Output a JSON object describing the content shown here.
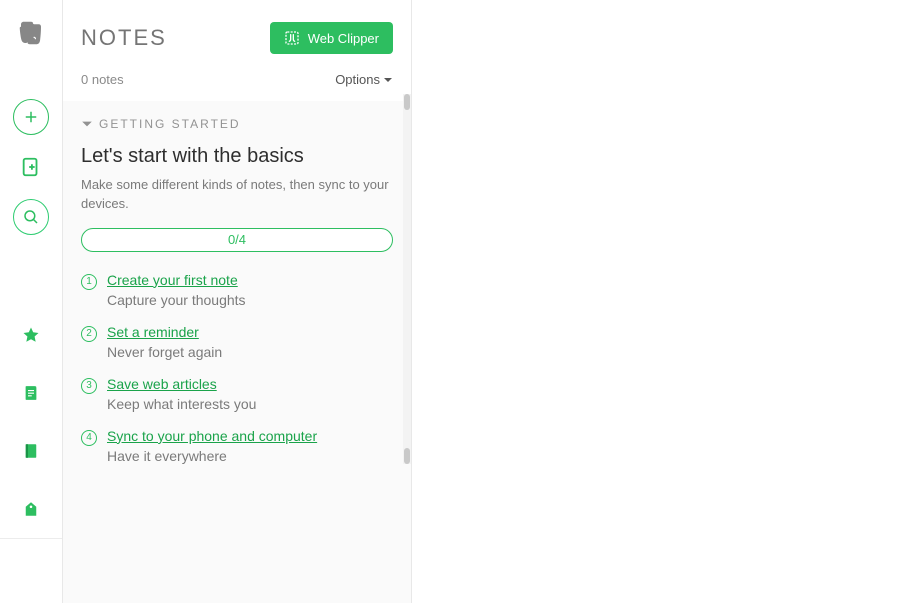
{
  "header": {
    "title": "NOTES",
    "web_clipper_label": "Web Clipper",
    "note_count_text": "0 notes",
    "options_label": "Options"
  },
  "getting_started": {
    "section_label": "GETTING STARTED",
    "title": "Let's start with the basics",
    "subtitle": "Make some different kinds of notes, then sync to your devices.",
    "progress_text": "0/4",
    "steps": [
      {
        "num": "1",
        "link": "Create your first note",
        "desc": "Capture your thoughts"
      },
      {
        "num": "2",
        "link": "Set a reminder",
        "desc": "Never forget again"
      },
      {
        "num": "3",
        "link": "Save web articles",
        "desc": "Keep what interests you"
      },
      {
        "num": "4",
        "link": "Sync to your phone and computer",
        "desc": "Have it everywhere"
      }
    ]
  }
}
